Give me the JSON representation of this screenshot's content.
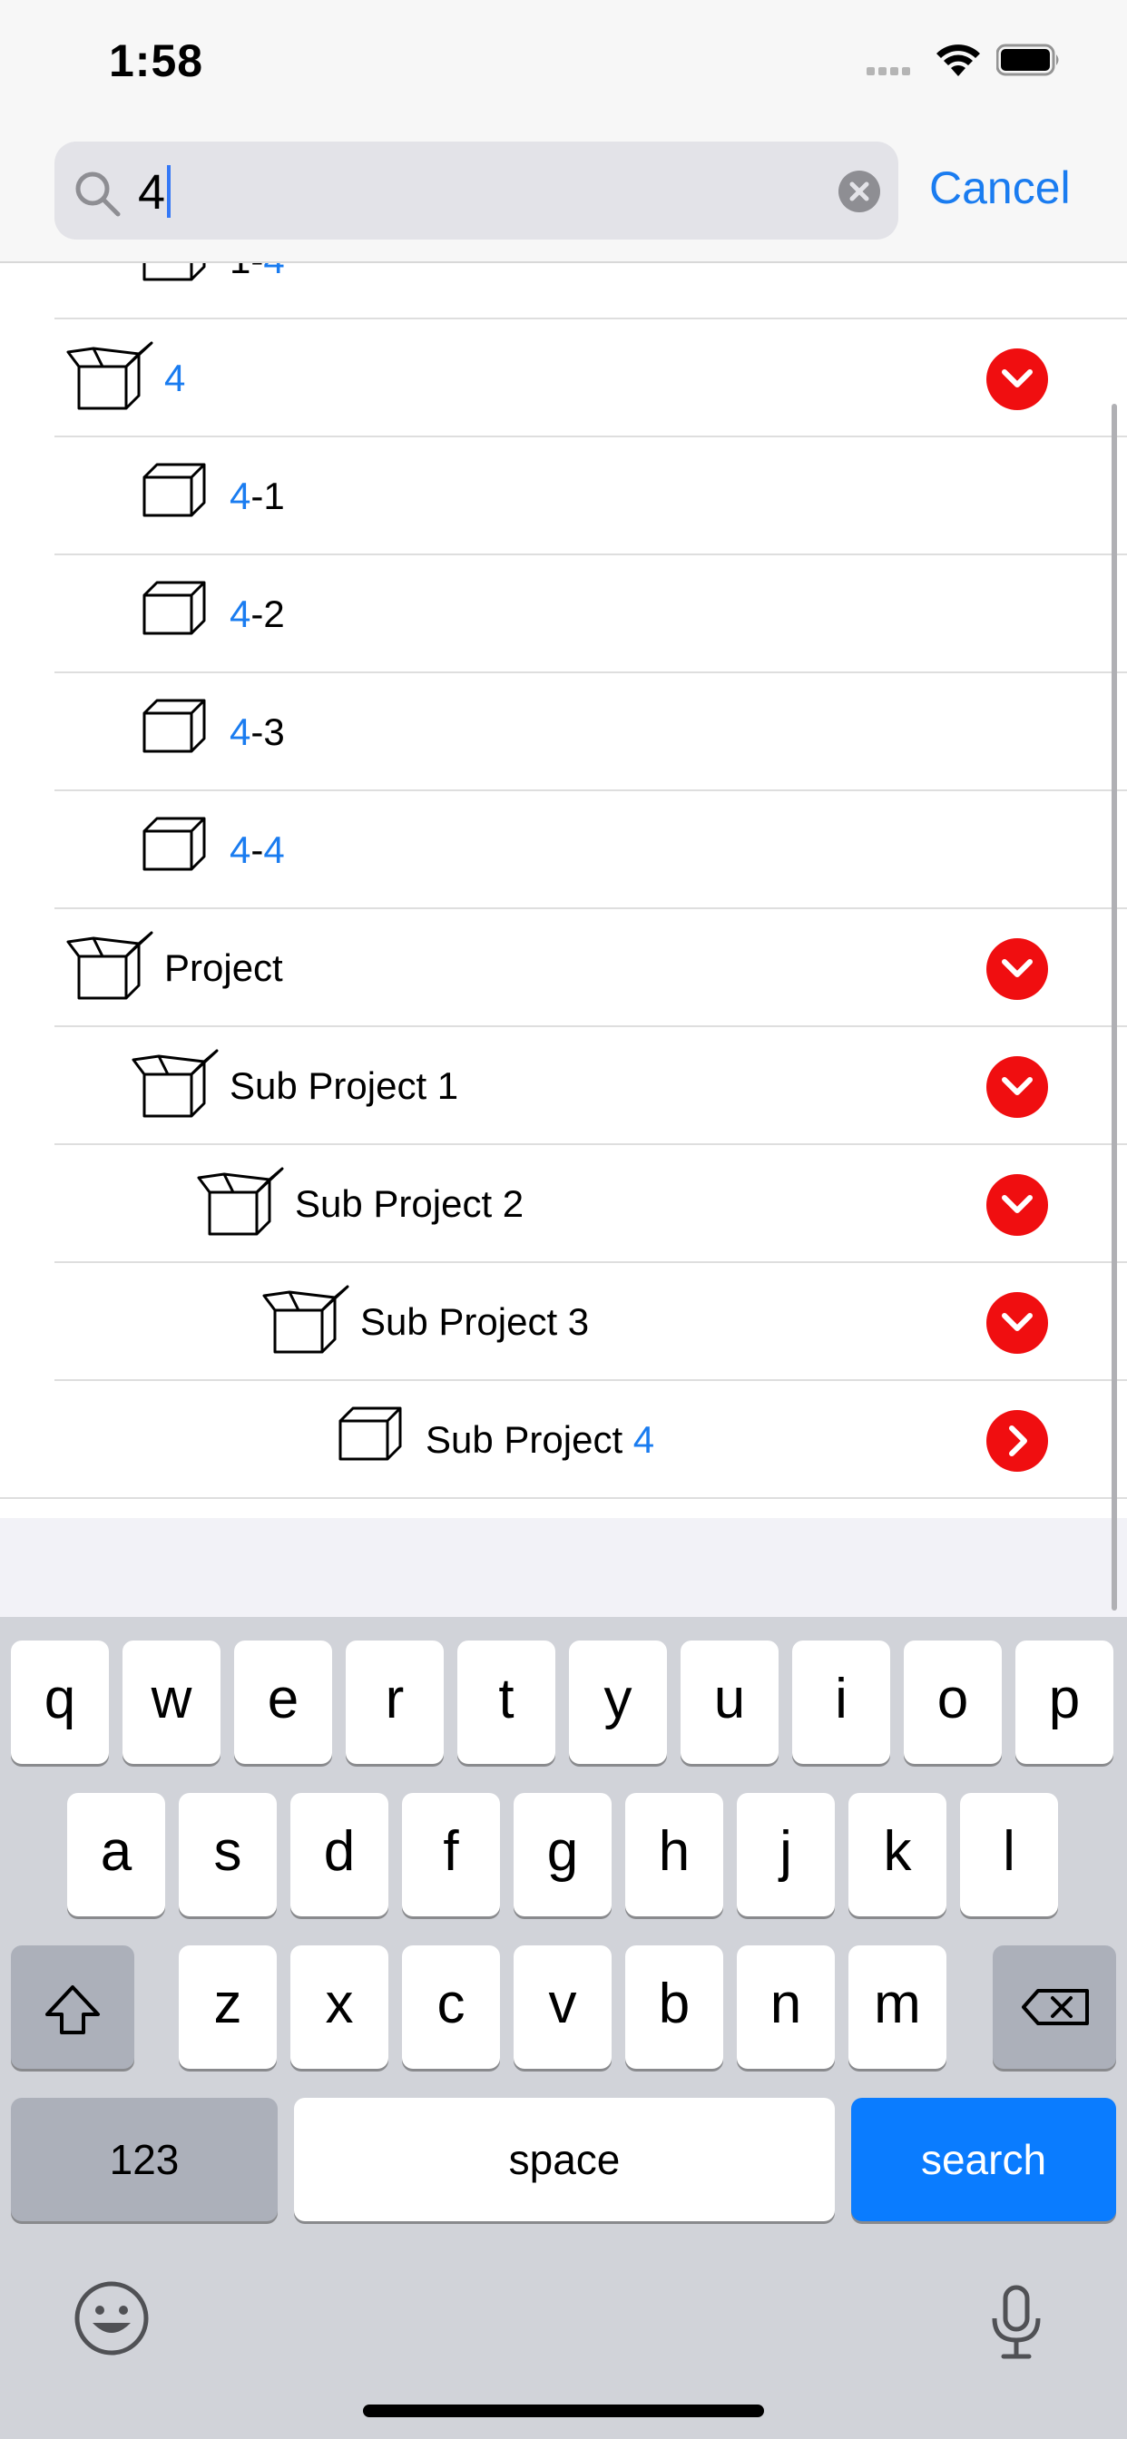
{
  "status_bar": {
    "time": "1:58"
  },
  "search": {
    "query": "4",
    "cancel_label": "Cancel"
  },
  "list": {
    "rows": [
      {
        "prefix": "1-",
        "highlight": "4",
        "suffix": ""
      },
      {
        "prefix": "",
        "highlight": "4",
        "suffix": ""
      },
      {
        "prefix": "",
        "highlight": "4",
        "suffix": "-1"
      },
      {
        "prefix": "",
        "highlight": "4",
        "suffix": "-2"
      },
      {
        "prefix": "",
        "highlight": "4",
        "suffix": "-3"
      },
      {
        "prefix": "",
        "highlight": "4",
        "suffix": "-",
        "suffix2": "4"
      },
      {
        "prefix": "Project",
        "highlight": "",
        "suffix": ""
      },
      {
        "prefix": "Sub Project 1",
        "highlight": "",
        "suffix": ""
      },
      {
        "prefix": "Sub Project 2",
        "highlight": "",
        "suffix": ""
      },
      {
        "prefix": "Sub Project 3",
        "highlight": "",
        "suffix": ""
      },
      {
        "prefix": "Sub Project ",
        "highlight": "4",
        "suffix": ""
      }
    ]
  },
  "keyboard": {
    "row1": [
      "q",
      "w",
      "e",
      "r",
      "t",
      "y",
      "u",
      "i",
      "o",
      "p"
    ],
    "row2": [
      "a",
      "s",
      "d",
      "f",
      "g",
      "h",
      "j",
      "k",
      "l"
    ],
    "row3": [
      "z",
      "x",
      "c",
      "v",
      "b",
      "n",
      "m"
    ],
    "numbers_label": "123",
    "space_label": "space",
    "search_label": "search"
  }
}
